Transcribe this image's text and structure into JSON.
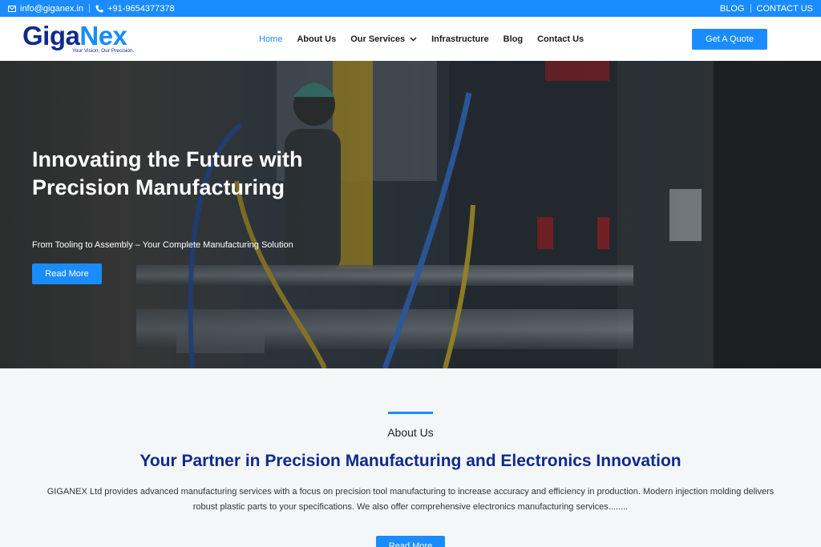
{
  "topbar": {
    "email": "info@giganex.in",
    "phone": "+91-9654377378",
    "links": [
      "BLOG",
      "CONTACT US"
    ]
  },
  "logo": {
    "part1": "Giga",
    "part2": "Nex",
    "tagline": "Your Vision, Our Precision."
  },
  "nav": {
    "items": [
      "Home",
      "About Us",
      "Our Services",
      "Infrastructure",
      "Blog",
      "Contact Us"
    ],
    "active": "Home"
  },
  "header": {
    "quote_label": "Get A Quote"
  },
  "hero": {
    "title": "Innovating the Future with Precision Manufacturing",
    "subtitle": "From Tooling to Assembly – Your Complete Manufacturing Solution",
    "button_label": "Read More"
  },
  "about": {
    "kicker": "About Us",
    "heading": "Your Partner in Precision Manufacturing and Electronics Innovation",
    "description": "GIGANEX Ltd provides advanced manufacturing services with a focus on precision tool manufacturing to increase accuracy and efficiency in production. Modern injection molding delivers robust plastic parts to your specifications. We also offer comprehensive electronics manufacturing services........",
    "button_label": "Read More"
  },
  "colors": {
    "accent": "#1a8cff",
    "brand_dark": "#0f2a8c"
  },
  "icons": {
    "email": "envelope-icon",
    "phone": "phone-icon",
    "dropdown": "chevron-down-icon"
  }
}
